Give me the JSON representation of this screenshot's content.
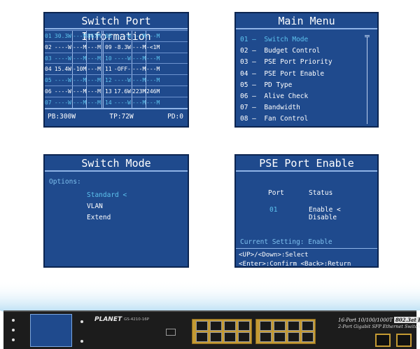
{
  "port_info": {
    "title": "Switch Port Information",
    "rows": [
      {
        "n1": "01",
        "w1": "30.3W",
        "a1": "---M",
        "b1": "867M",
        "n2": "08",
        "w2": "----W",
        "a2": "---M",
        "b2": "---M",
        "hl": true
      },
      {
        "n1": "02",
        "w1": "----W",
        "a1": "---M",
        "b1": "---M",
        "n2": "09",
        "w2": "-8.3W",
        "a2": "---M",
        "b2": "-<1M",
        "hl": false
      },
      {
        "n1": "03",
        "w1": "----W",
        "a1": "---M",
        "b1": "---M",
        "n2": "10",
        "w2": "----W",
        "a2": "---M",
        "b2": "---M",
        "hl": true
      },
      {
        "n1": "04",
        "w1": "15.4W",
        "a1": "-10M",
        "b1": "---M",
        "n2": "11",
        "w2": "-OFF-",
        "a2": "---M",
        "b2": "---M",
        "hl": false
      },
      {
        "n1": "05",
        "w1": "----W",
        "a1": "---M",
        "b1": "---M",
        "n2": "12",
        "w2": "----W",
        "a2": "---M",
        "b2": "---M",
        "hl": true
      },
      {
        "n1": "06",
        "w1": "----W",
        "a1": "---M",
        "b1": "---M",
        "n2": "13",
        "w2": "17.6W",
        "a2": "223M",
        "b2": "246M",
        "hl": false
      },
      {
        "n1": "07",
        "w1": "----W",
        "a1": "---M",
        "b1": "---M",
        "n2": "14",
        "w2": "----W",
        "a2": "---M",
        "b2": "---M",
        "hl": true
      }
    ],
    "footer": {
      "pb": "PB:300W",
      "tp": "TP:72W",
      "pd": "PD:0"
    }
  },
  "main_menu": {
    "title": "Main Menu",
    "items": [
      "01 —  Switch Mode",
      "02 —  Budget Control",
      "03 —  PSE Port Priority",
      "04 —  PSE Port Enable",
      "05 —  PD Type",
      "06 —  Alive Check",
      "07 —  Bandwidth",
      "08 —  Fan Control"
    ]
  },
  "switch_mode": {
    "title": "Switch Mode",
    "options_label": "Options:",
    "options": [
      "Standard <",
      "VLAN",
      "Extend"
    ]
  },
  "pse_port_enable": {
    "title": "PSE Port Enable",
    "port_header": "Port",
    "status_header": "Status",
    "port_value": "01",
    "status_options": [
      "Enable <",
      "Disable"
    ],
    "current_setting": "Current Setting: Enable",
    "help1": "<UP>/<Down>:Select",
    "help2": "<Enter>:Confirm <Back>:Return"
  },
  "device": {
    "brand": "PLANET",
    "model": "GS-4210-16P",
    "desc_line1_prefix": "16-Port 10/100/1000T",
    "desc_line1_badge": "802.3at PoE",
    "desc_line1_suffix": " +",
    "desc_line2": "2-Port Gigabit SFP Ethernet Switch",
    "accent_blue": "#1f4a8d",
    "port_gold": "#c49a33"
  }
}
